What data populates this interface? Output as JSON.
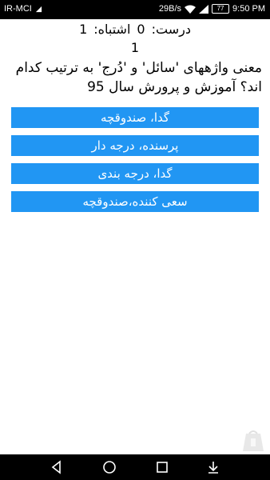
{
  "status_bar": {
    "carrier": "IR-MCI",
    "speed": "29B/s",
    "battery": "77",
    "time": "9:50 PM"
  },
  "score": {
    "correct_label": "درست:",
    "correct_value": "0",
    "wrong_label": "اشتباه:",
    "wrong_value": "1"
  },
  "question_number": "1",
  "question_text": "معنی واژههای 'سائل' و 'دُرج' به ترتیب کدام اند؟ آموزش و پرورش سال 95",
  "answers": [
    {
      "label": "گدا، صندوقچه"
    },
    {
      "label": "پرسنده، درجه دار"
    },
    {
      "label": "گدا، درجه بندی"
    },
    {
      "label": "سعی کننده،صندوقچه"
    }
  ],
  "colors": {
    "button": "#2196f3",
    "status_bar": "#000000",
    "nav_bar": "#000000"
  },
  "icons": {
    "nav": [
      "back-icon",
      "home-icon",
      "recents-icon",
      "download-icon"
    ]
  }
}
